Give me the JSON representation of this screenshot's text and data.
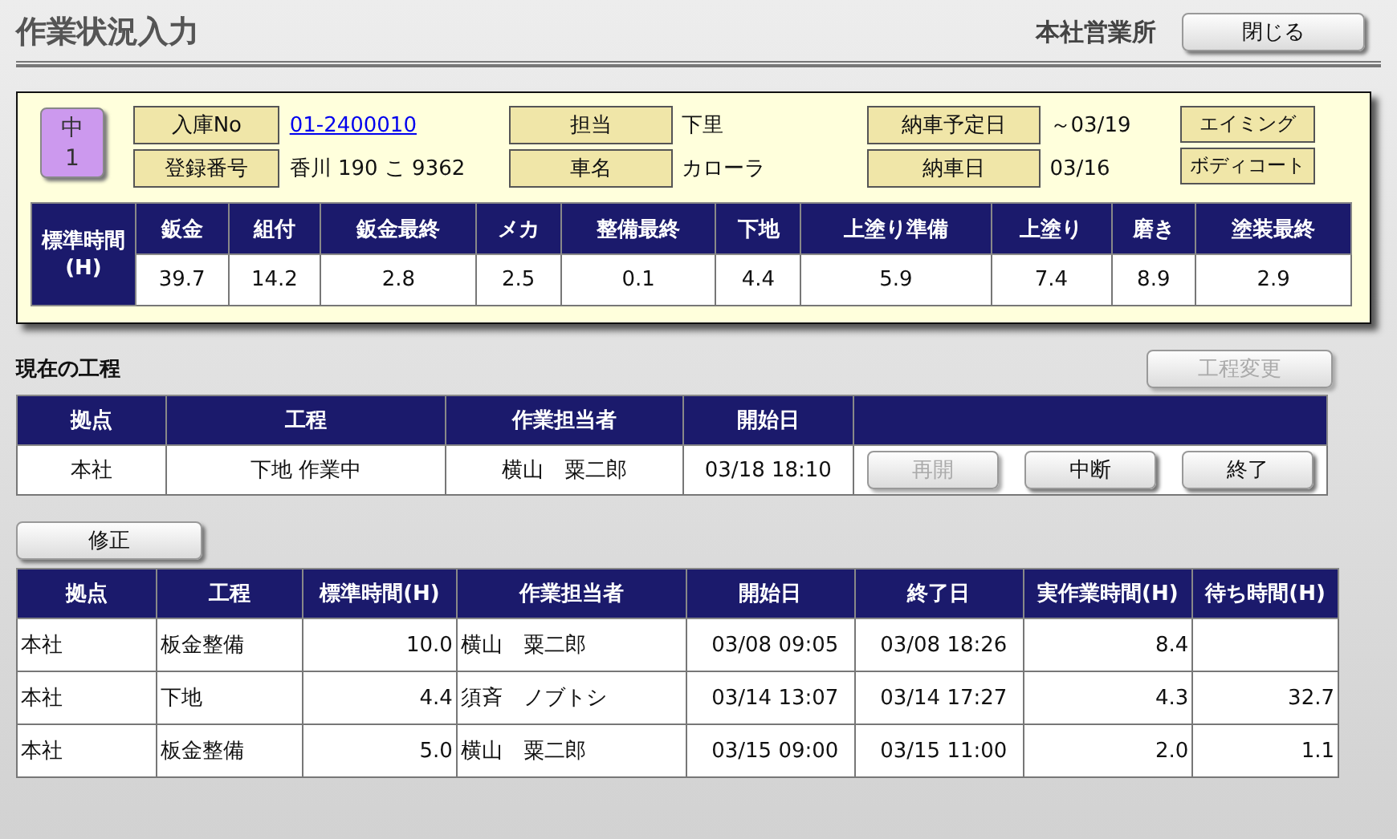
{
  "header": {
    "title": "作業状況入力",
    "office": "本社営業所",
    "close_button": "閉じる"
  },
  "order": {
    "priority": [
      "中",
      "1"
    ],
    "info_columns": [
      {
        "items": [
          {
            "label": "入庫No",
            "value": "01-2400010",
            "kind": "link"
          },
          {
            "label": "登録番号",
            "value": "香川 190 こ 9362",
            "kind": "text"
          }
        ]
      },
      {
        "items": [
          {
            "label": "担当",
            "value": "下里",
            "kind": "text"
          },
          {
            "label": "車名",
            "value": "カローラ",
            "kind": "text"
          }
        ]
      },
      {
        "items": [
          {
            "label": "納車予定日",
            "value": "～03/19",
            "kind": "text"
          },
          {
            "label": "納車日",
            "value": "03/16",
            "kind": "text"
          }
        ]
      },
      {
        "items": [
          {
            "label": "エイミング",
            "kind": "tag"
          },
          {
            "label": "ボディコート",
            "kind": "tag"
          }
        ]
      }
    ],
    "standard_time": {
      "row_header": [
        "標準時間",
        "(H)"
      ],
      "columns": [
        {
          "label": "鈑金",
          "value": "39.7"
        },
        {
          "label": "組付",
          "value": "14.2"
        },
        {
          "label": "鈑金最終",
          "value": "2.8"
        },
        {
          "label": "メカ",
          "value": "2.5"
        },
        {
          "label": "整備最終",
          "value": "0.1"
        },
        {
          "label": "下地",
          "value": "4.4"
        },
        {
          "label": "上塗り準備",
          "value": "5.9"
        },
        {
          "label": "上塗り",
          "value": "7.4"
        },
        {
          "label": "磨き",
          "value": "8.9"
        },
        {
          "label": "塗装最終",
          "value": "2.9"
        }
      ]
    }
  },
  "current_process": {
    "title": "現在の工程",
    "change_button": {
      "label": "工程変更",
      "disabled": true
    },
    "columns": [
      "拠点",
      "工程",
      "作業担当者",
      "開始日"
    ],
    "row": [
      "本社",
      "下地 作業中",
      "横山　粟二郎",
      "03/18  18:10"
    ],
    "actions": [
      {
        "label": "再開",
        "disabled": true
      },
      {
        "label": "中断",
        "disabled": false
      },
      {
        "label": "終了",
        "disabled": false
      }
    ]
  },
  "edit_button": "修正",
  "history": {
    "columns": [
      "拠点",
      "工程",
      "標準時間(H)",
      "作業担当者",
      "開始日",
      "終了日",
      "実作業時間(H)",
      "待ち時間(H)"
    ],
    "rows": [
      [
        "本社",
        "板金整備",
        "10.0",
        "横山　粟二郎",
        "03/08  09:05",
        "03/08  18:26",
        "8.4",
        ""
      ],
      [
        "本社",
        "下地",
        "4.4",
        "須斉　ノブトシ",
        "03/14  13:07",
        "03/14  17:27",
        "4.3",
        "32.7"
      ],
      [
        "本社",
        "板金整備",
        "5.0",
        "横山　粟二郎",
        "03/15  09:00",
        "03/15  11:00",
        "2.0",
        "1.1"
      ]
    ]
  }
}
